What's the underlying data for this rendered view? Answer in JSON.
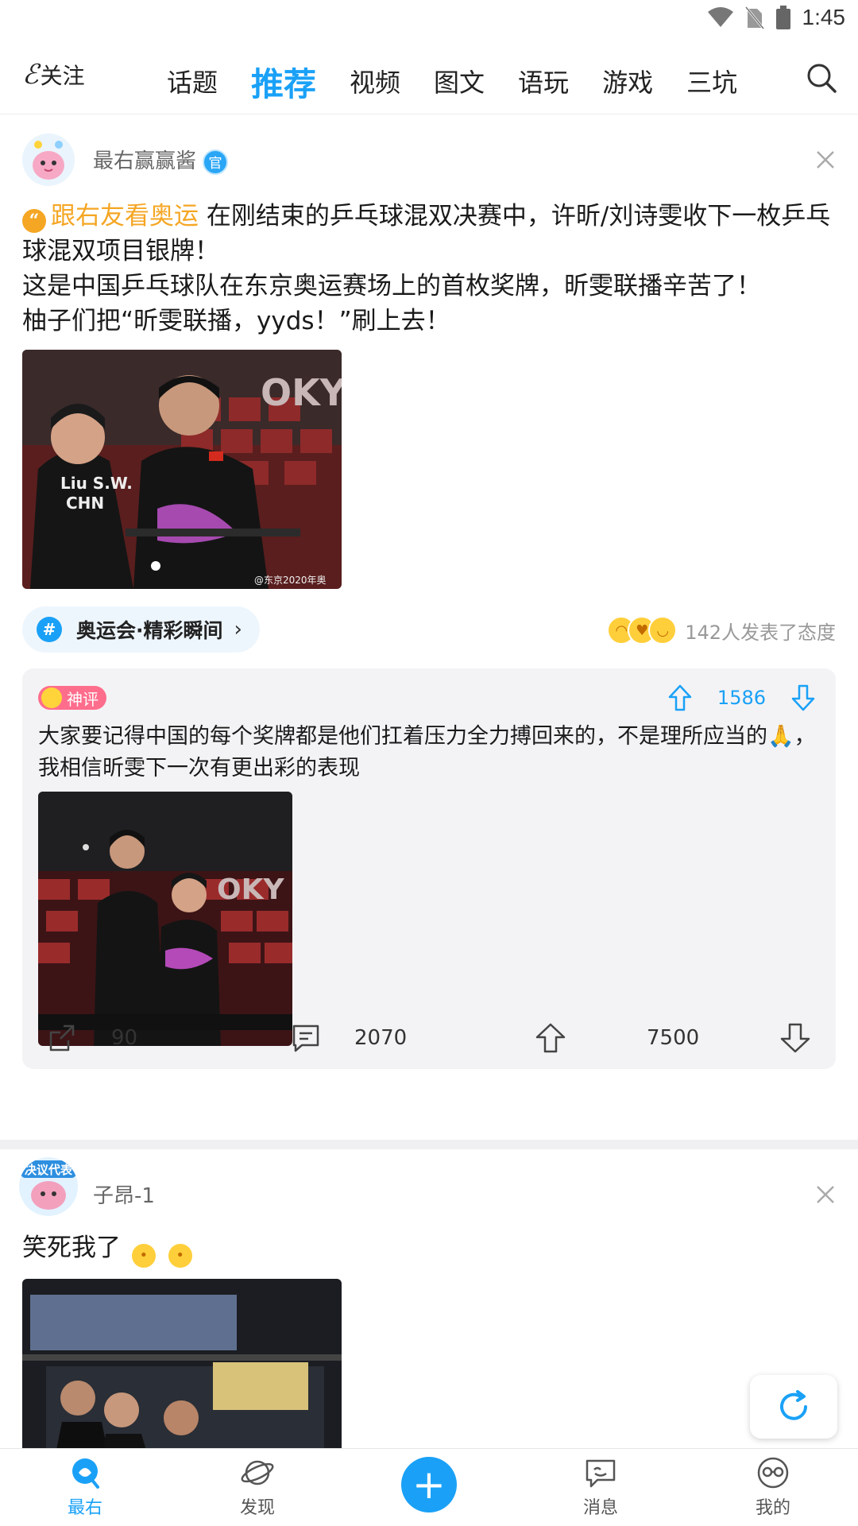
{
  "status_bar": {
    "time": "1:45"
  },
  "top_nav": {
    "follow_label": "关注",
    "tabs": [
      "话题",
      "推荐",
      "视频",
      "图文",
      "语玩",
      "游戏",
      "三坑"
    ],
    "active_tab": "推荐"
  },
  "posts": [
    {
      "author": "最右赢赢酱",
      "official_badge": "官",
      "topic_tag": "跟右友看奥运",
      "text_lines": [
        "在刚结束的乒乓球混双决赛中，许昕/刘诗雯收下一枚乒乓球混双项目银牌！",
        "这是中国乒乓球队在东京奥运赛场上的首枚奖牌，昕雯联播辛苦了！",
        "柚子们把“昕雯联播，yyds！”刷上去！"
      ],
      "image_watermark": "@东京2020年奥",
      "topic_chip": "奥运会·精彩瞬间",
      "reaction_text": "142人发表了态度",
      "god_comment": {
        "badge": "神评",
        "votes": "1586",
        "text": "大家要记得中国的每个奖牌都是他们扛着压力全力搏回来的，不是理所应当的🙏，我相信昕雯下一次有更出彩的表现"
      },
      "actions": {
        "share": "90",
        "comments": "2070",
        "likes": "7500"
      }
    },
    {
      "author": "子昂-1",
      "avatar_text": "决议代表",
      "text": "笑死我了"
    }
  ],
  "bottom_nav": {
    "items": [
      {
        "label": "最右",
        "icon": "home-icon"
      },
      {
        "label": "发现",
        "icon": "planet-icon"
      },
      {
        "label": "消息",
        "icon": "message-icon"
      },
      {
        "label": "我的",
        "icon": "glasses-icon"
      }
    ],
    "active": "最右"
  },
  "colors": {
    "accent": "#1aa1f7",
    "topic": "#f5a623",
    "god_badge": "#ff6d8c"
  }
}
